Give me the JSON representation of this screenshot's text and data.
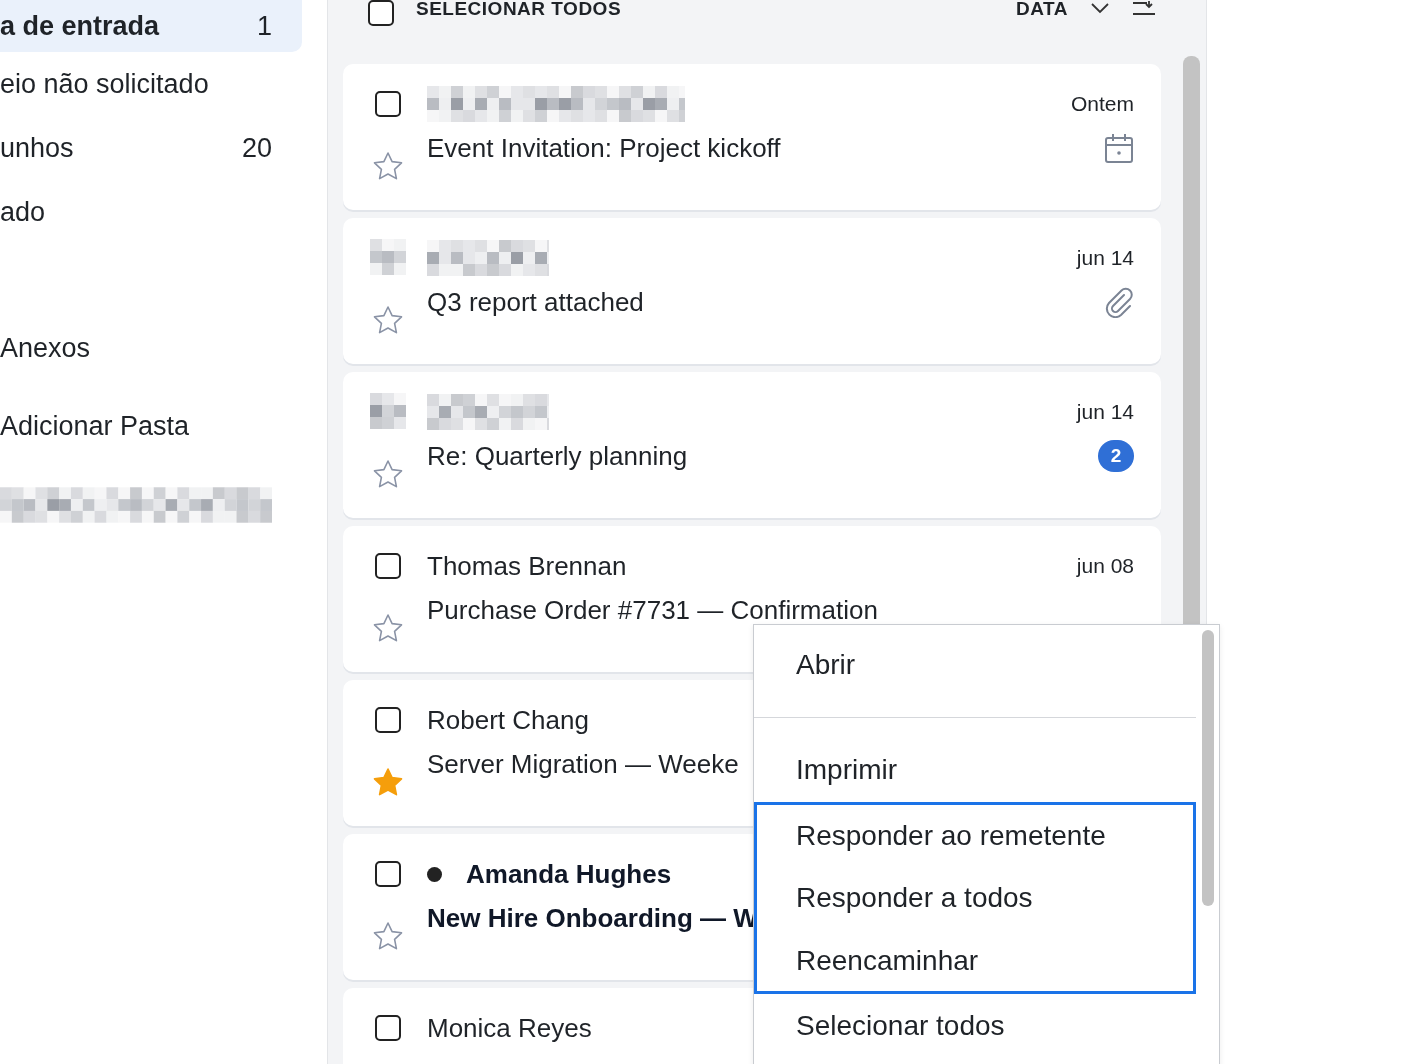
{
  "sidebar": {
    "items": [
      {
        "kind": "folder",
        "label": "a de entrada",
        "count": "1",
        "selected": true
      },
      {
        "kind": "folder",
        "label": "eio não solicitado",
        "selected": false
      },
      {
        "kind": "folder",
        "label": "unhos",
        "count": "20",
        "selected": false
      },
      {
        "kind": "folder",
        "label": "ado",
        "selected": false
      },
      {
        "kind": "section",
        "label": "Anexos",
        "selected": false
      },
      {
        "kind": "action",
        "label": "Adicionar Pasta",
        "selected": false
      },
      {
        "kind": "redacted",
        "selected": false
      }
    ]
  },
  "list_header": {
    "select_all": {
      "label": "SELECIONAR TODOS",
      "checked": false
    },
    "sort": {
      "label": "DATA"
    }
  },
  "messages": [
    {
      "checked": false,
      "sender_redacted": true,
      "subject": "Event Invitation: Project kickoff",
      "date": "Ontem",
      "indicator": {
        "kind": "calendar"
      },
      "starred": false
    },
    {
      "avatar": {
        "kind": "redacted"
      },
      "sender_redacted": true,
      "subject": "Q3 report attached",
      "date": "jun 14",
      "indicator": {
        "kind": "attachment"
      },
      "starred": false
    },
    {
      "avatar": {
        "kind": "redacted"
      },
      "sender_redacted": true,
      "subject": "Re: Quarterly planning",
      "date": "jun 14",
      "indicator": {
        "kind": "count",
        "count": "2"
      },
      "starred": false
    },
    {
      "checked": false,
      "sender": "Thomas Brennan",
      "subject": "Purchase Order #7731 — Confirmation",
      "date": "jun 08",
      "starred": false,
      "unread": false
    },
    {
      "checked": false,
      "sender": "Robert Chang",
      "subject": "Server Migration — Weeke",
      "starred": true,
      "unread": false
    },
    {
      "checked": false,
      "sender": "Amanda Hughes",
      "subject": "New Hire Onboarding — W",
      "starred": false,
      "unread": true
    },
    {
      "checked": false,
      "sender": "Monica Reyes",
      "unread": false
    }
  ],
  "context_menu": {
    "items": [
      {
        "kind": "item",
        "label": "Abrir",
        "focused": false
      },
      {
        "kind": "separator"
      },
      {
        "kind": "item",
        "label": "Imprimir",
        "focused": false
      },
      {
        "kind": "item",
        "label": "Responder ao remetente",
        "focused": true
      },
      {
        "kind": "item",
        "label": "Responder a todos",
        "focused": true
      },
      {
        "kind": "item",
        "label": "Reencaminhar",
        "focused": true
      },
      {
        "kind": "item",
        "label": "Selecionar todos",
        "focused": false
      }
    ]
  }
}
